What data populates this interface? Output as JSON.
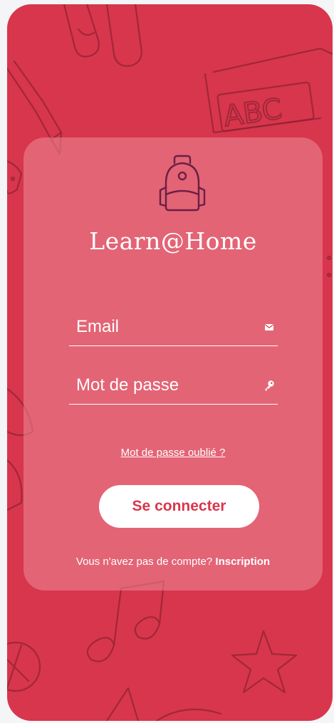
{
  "app": {
    "title": "Learn@Home",
    "background_color": "#d8364d",
    "accent_color": "#d8364d"
  },
  "logo": {
    "icon": "backpack-icon",
    "color": "#6b1f45"
  },
  "background_doodles": {
    "text": "ABC"
  },
  "form": {
    "email": {
      "placeholder": "Email",
      "value": "",
      "icon": "envelope-icon"
    },
    "password": {
      "placeholder": "Mot de passe",
      "value": "",
      "icon": "key-icon"
    },
    "forgot_password_label": "Mot de passe oublié ?",
    "submit_label": "Se connecter"
  },
  "signup": {
    "prompt": "Vous n'avez pas de compte?",
    "link_label": "Inscription"
  }
}
